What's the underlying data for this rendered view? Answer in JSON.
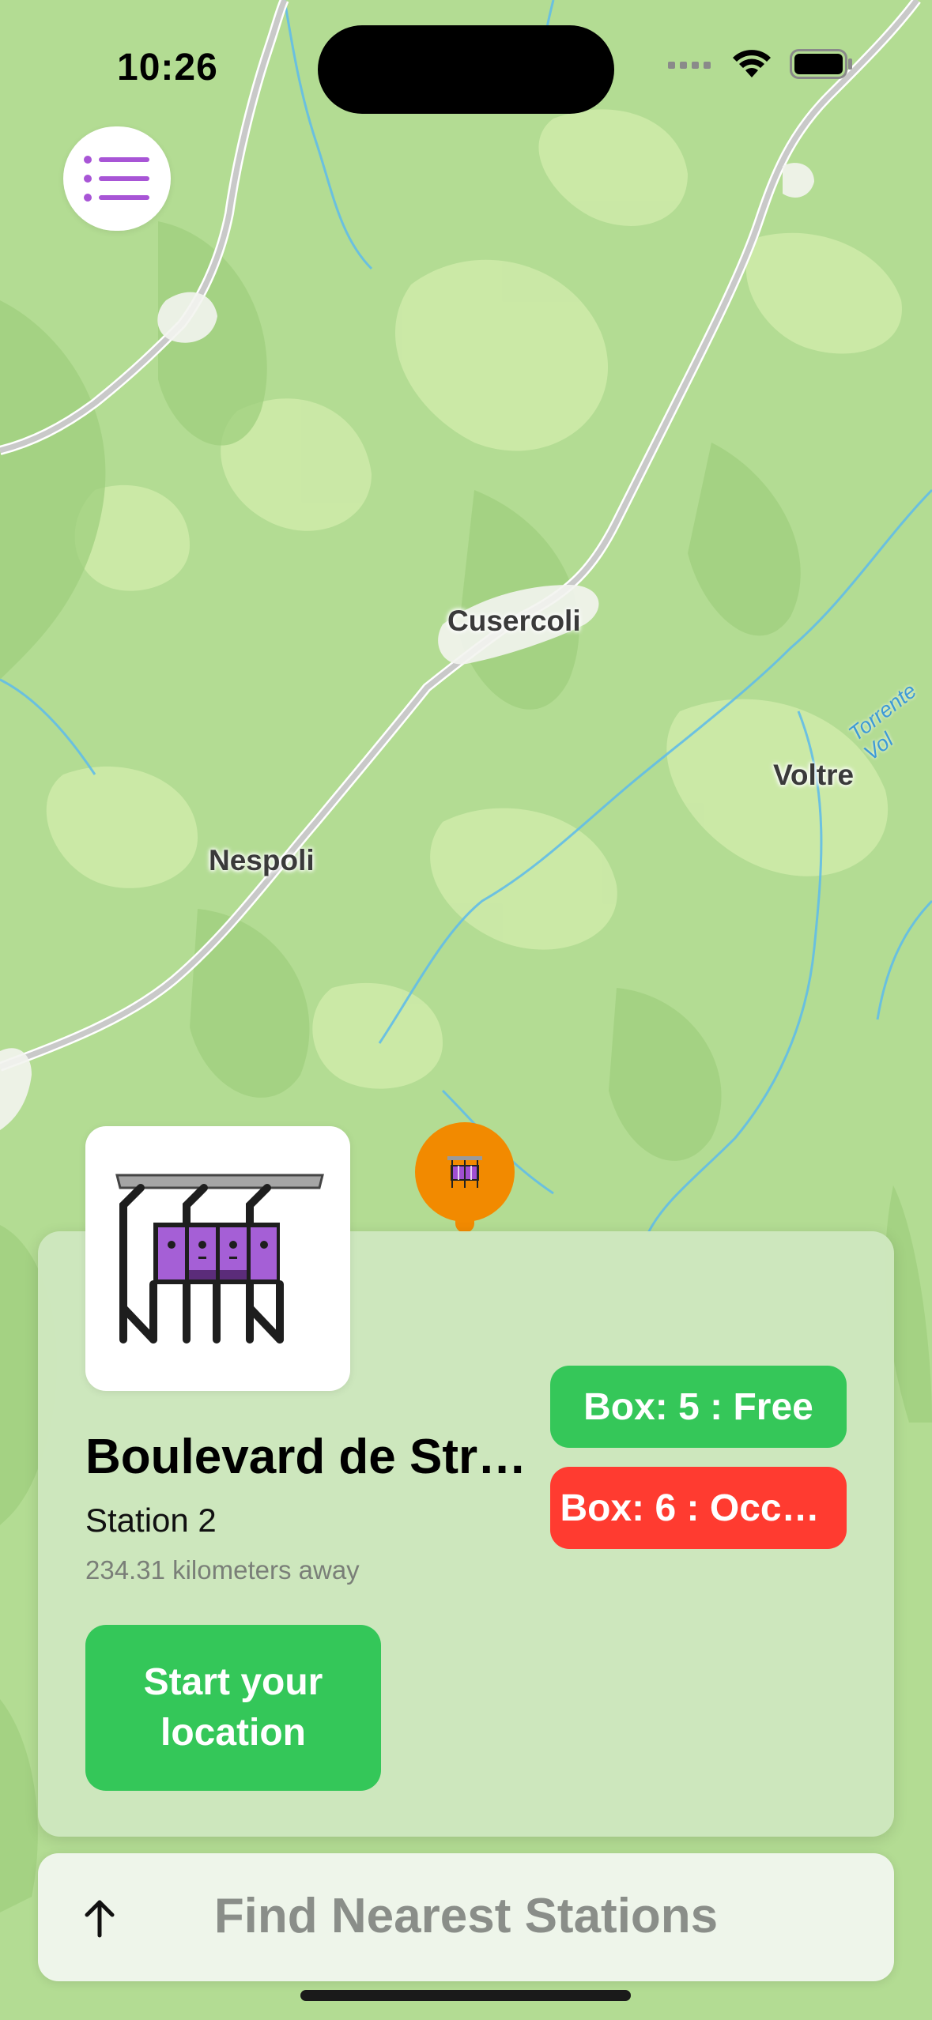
{
  "status_bar": {
    "time": "10:26",
    "signal_icon": "cellular-signal-icon",
    "wifi_icon": "wifi-icon",
    "battery_icon": "battery-icon"
  },
  "menu_button": {
    "icon": "list-icon",
    "accent": "#a855d6"
  },
  "map": {
    "places": [
      "Cusercoli",
      "Voltre",
      "Nespoli"
    ],
    "water_label": "Torrente Vol"
  },
  "map_pin": {
    "icon": "locker-station-icon",
    "color": "#f28a00"
  },
  "station_card": {
    "name": "Boulevard de Str…",
    "subtitle": "Station 2",
    "distance": "234.31 kilometers away",
    "start_button": "Start your location",
    "boxes": [
      {
        "label": "Box: 5 : Free",
        "status_color": "#35c759"
      },
      {
        "label": "Box: 6 : Occu…",
        "status_color": "#ff3b30"
      }
    ]
  },
  "find_bar": {
    "label": "Find Nearest Stations",
    "icon": "arrow-up-icon"
  }
}
